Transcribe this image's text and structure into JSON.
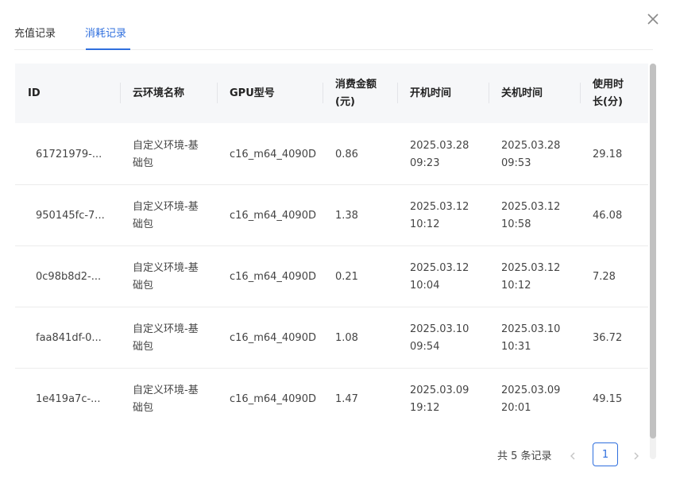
{
  "tabs": [
    {
      "label": "充值记录",
      "active": false
    },
    {
      "label": "消耗记录",
      "active": true
    }
  ],
  "table": {
    "columns": [
      {
        "key": "id",
        "label": "ID"
      },
      {
        "key": "env",
        "label": "云环境名称"
      },
      {
        "key": "gpu",
        "label": "GPU型号"
      },
      {
        "key": "cost",
        "label_line1": "消费金额",
        "label_line2": "(元)"
      },
      {
        "key": "start",
        "label": "开机时间"
      },
      {
        "key": "stop",
        "label": "关机时间"
      },
      {
        "key": "duration",
        "label_line1": "使用时",
        "label_line2": "长(分)"
      }
    ],
    "rows": [
      {
        "id": "61721979-...",
        "env_line1": "自定义环境-基",
        "env_line2": "础包",
        "gpu": "c16_m64_4090D",
        "cost": "0.86",
        "start_date": "2025.03.28",
        "start_time": "09:23",
        "stop_date": "2025.03.28",
        "stop_time": "09:53",
        "duration": "29.18"
      },
      {
        "id": "950145fc-7...",
        "env_line1": "自定义环境-基",
        "env_line2": "础包",
        "gpu": "c16_m64_4090D",
        "cost": "1.38",
        "start_date": "2025.03.12",
        "start_time": "10:12",
        "stop_date": "2025.03.12",
        "stop_time": "10:58",
        "duration": "46.08"
      },
      {
        "id": "0c98b8d2-...",
        "env_line1": "自定义环境-基",
        "env_line2": "础包",
        "gpu": "c16_m64_4090D",
        "cost": "0.21",
        "start_date": "2025.03.12",
        "start_time": "10:04",
        "stop_date": "2025.03.12",
        "stop_time": "10:12",
        "duration": "7.28"
      },
      {
        "id": "faa841df-0...",
        "env_line1": "自定义环境-基",
        "env_line2": "础包",
        "gpu": "c16_m64_4090D",
        "cost": "1.08",
        "start_date": "2025.03.10",
        "start_time": "09:54",
        "stop_date": "2025.03.10",
        "stop_time": "10:31",
        "duration": "36.72"
      },
      {
        "id": "1e419a7c-...",
        "env_line1": "自定义环境-基",
        "env_line2": "础包",
        "gpu": "c16_m64_4090D",
        "cost": "1.47",
        "start_date": "2025.03.09",
        "start_time": "19:12",
        "stop_date": "2025.03.09",
        "stop_time": "20:01",
        "duration": "49.15"
      }
    ]
  },
  "pagination": {
    "total_text": "共 5 条记录",
    "current_page": "1"
  },
  "icons": {
    "close": "close-icon",
    "prev": "chevron-left-icon",
    "next": "chevron-right-icon"
  },
  "colors": {
    "accent": "#2f6fde",
    "header_bg": "#f6f7f9",
    "border": "#ececec"
  }
}
